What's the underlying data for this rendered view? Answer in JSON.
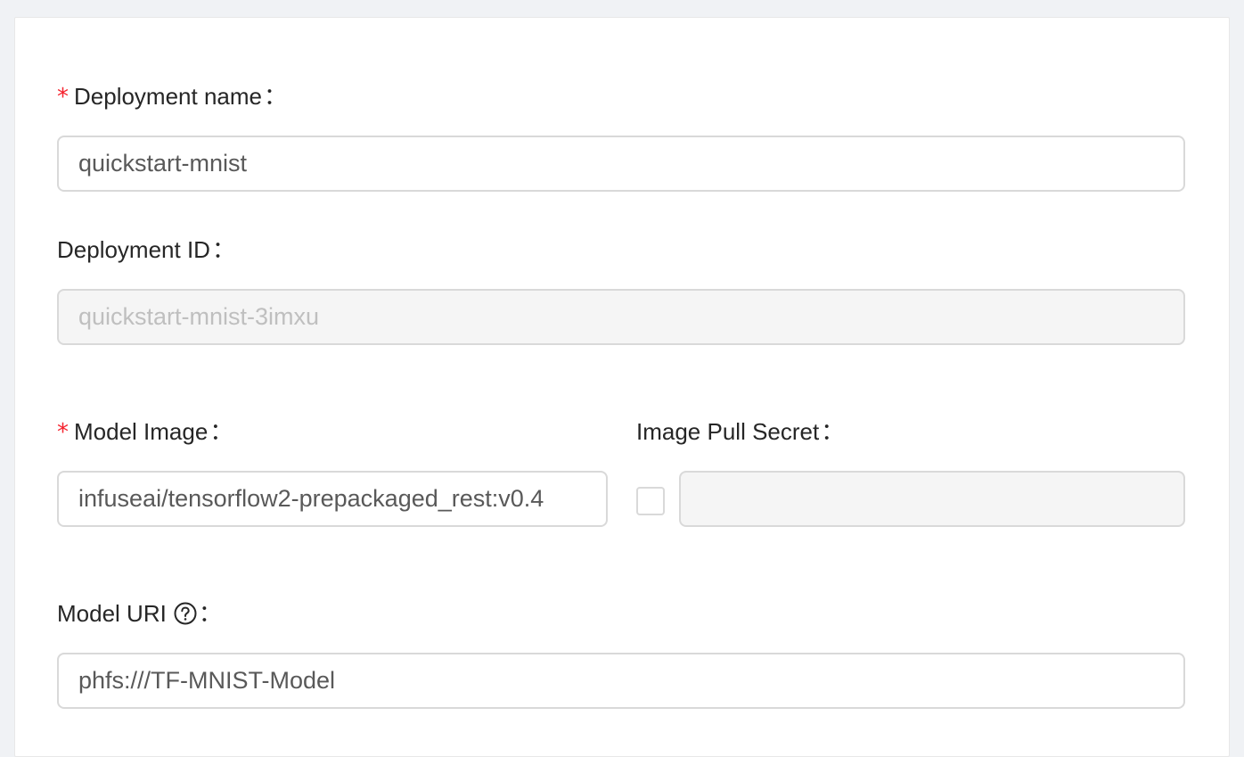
{
  "form": {
    "deployment_name": {
      "label": "Deployment name",
      "required_mark": "*",
      "colon": "：",
      "value": "quickstart-mnist"
    },
    "deployment_id": {
      "label": "Deployment ID",
      "colon": "：",
      "value": "quickstart-mnist-3imxu"
    },
    "model_image": {
      "label": "Model Image",
      "required_mark": "*",
      "colon": "：",
      "value": "infuseai/tensorflow2-prepackaged_rest:v0.4"
    },
    "image_pull_secret": {
      "label": "Image Pull Secret",
      "colon": "：",
      "checked": false,
      "value": ""
    },
    "model_uri": {
      "label": "Model URI",
      "colon": "：",
      "help_icon": "question-circle-icon",
      "value": "phfs:///TF-MNIST-Model"
    }
  },
  "colors": {
    "required": "#f5222d",
    "border": "#d9d9d9",
    "disabled_bg": "#f5f5f5",
    "page_bg": "#f0f2f5"
  }
}
